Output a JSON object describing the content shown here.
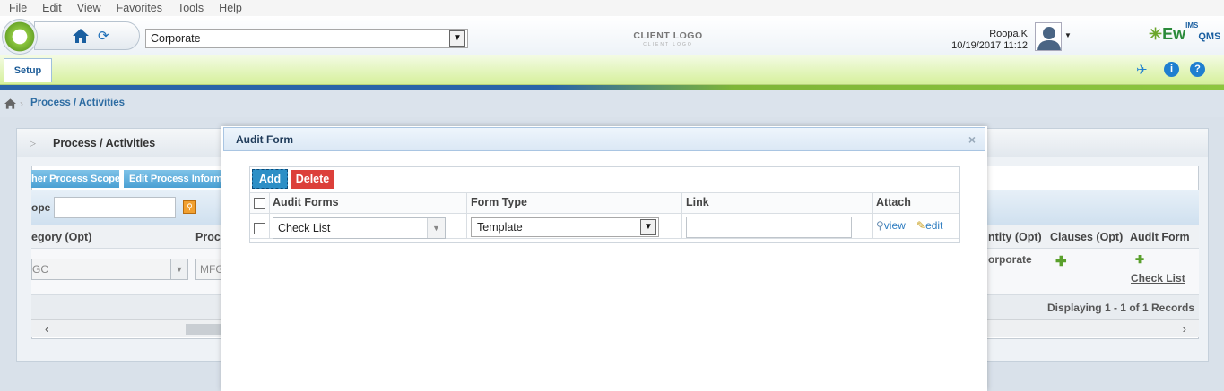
{
  "menu": [
    "File",
    "Edit",
    "View",
    "Favorites",
    "Tools",
    "Help"
  ],
  "header": {
    "org_select": "Corporate",
    "client_logo": "CLIENT LOGO",
    "client_logo_sub": "CLIENT LOGO",
    "user_name": "Roopa.K",
    "datetime": "10/19/2017 11:12",
    "brand": "Ew",
    "brand_sup": "IMS",
    "brand_sub": "QMS"
  },
  "toolbar": {
    "setup_label": "Setup"
  },
  "breadcrumb": {
    "path": "Process / Activities"
  },
  "background": {
    "panel_title": "Process / Activities",
    "btn_scope": "her Process Scope",
    "btn_edit_info": "Edit Process Inform",
    "filter_label": "ope",
    "headers": {
      "category": "egory (Opt)",
      "process": "Proc",
      "entity": "ntity (Opt)",
      "clauses": "Clauses (Opt)",
      "audit_form": "Audit Form"
    },
    "row": {
      "category_val": "GC",
      "process_val": "MFG",
      "entity_val": "orporate",
      "audit_link": "Check List"
    },
    "footer": "Displaying 1 - 1 of 1 Records"
  },
  "modal": {
    "title": "Audit Form",
    "close": "×",
    "add_label": "Add",
    "delete_label": "Delete",
    "columns": [
      "Audit Forms",
      "Form Type",
      "Link",
      "Attach"
    ],
    "row": {
      "audit_form": "Check List",
      "form_type": "Template",
      "link": "",
      "view": "view",
      "edit": "edit"
    }
  },
  "colors": {
    "accent_blue": "#2d8fc6",
    "delete_red": "#dc3f3a",
    "toolbar_green": "#d6f09c"
  }
}
